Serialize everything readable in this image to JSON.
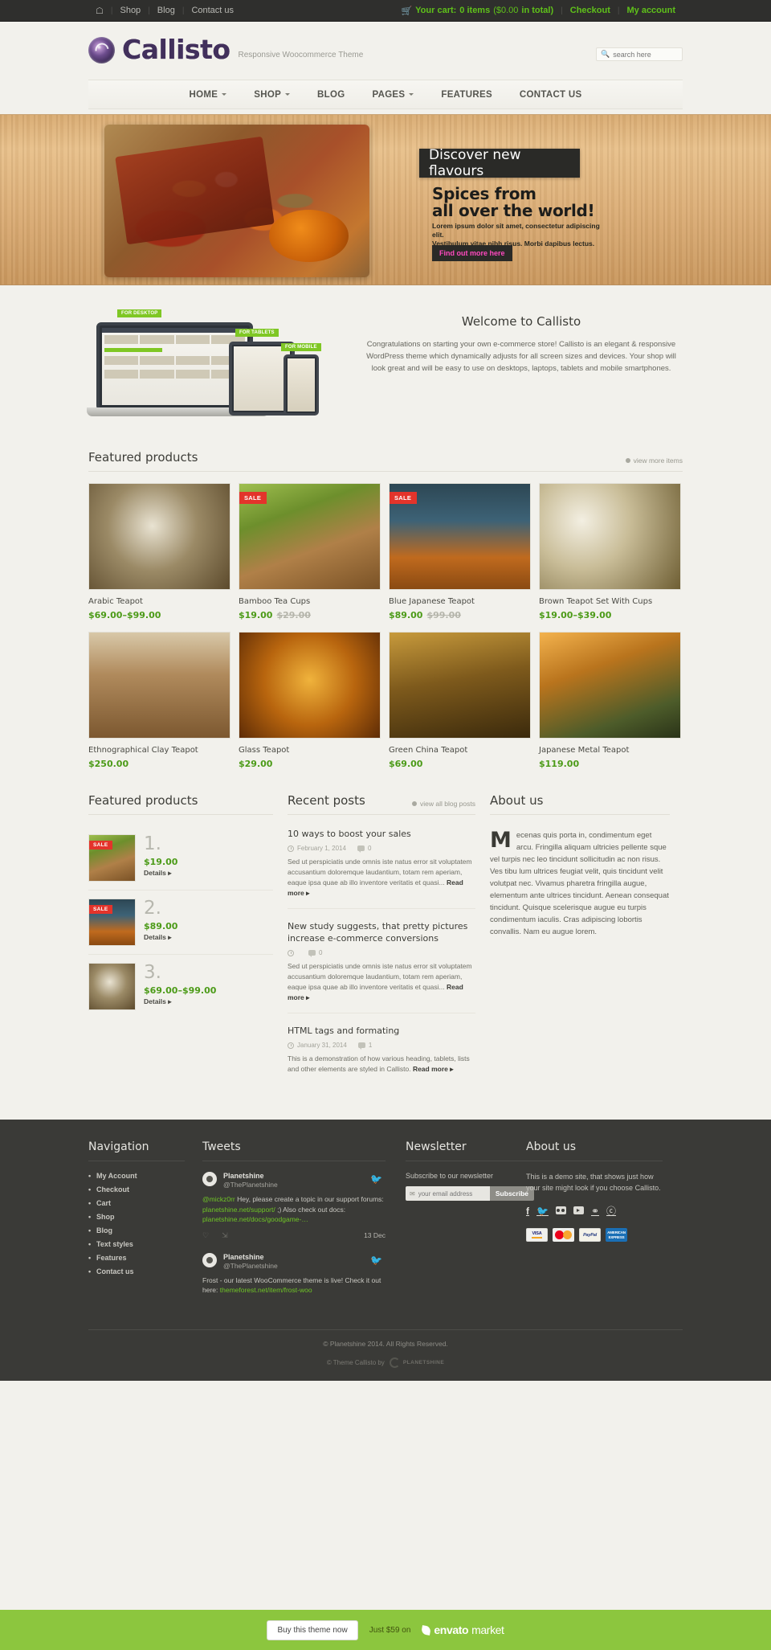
{
  "topbar": {
    "home_icon": "home-icon",
    "links": [
      "Shop",
      "Blog",
      "Contact us"
    ],
    "cart_icon": "cart-icon",
    "cart_label": "Your cart:",
    "cart_items": "0 items",
    "cart_total": "($0.00",
    "cart_total_suffix": "in total)",
    "checkout": "Checkout",
    "account": "My account"
  },
  "header": {
    "logo_text": "Callisto",
    "logo_icon": "spiral-logo-icon",
    "tagline": "Responsive Woocommerce Theme",
    "search_icon": "search-icon",
    "search_placeholder": "search here",
    "search_value": ""
  },
  "nav": {
    "items": [
      {
        "label": "HOME",
        "has_caret": true
      },
      {
        "label": "SHOP",
        "has_caret": true
      },
      {
        "label": "BLOG",
        "has_caret": false
      },
      {
        "label": "PAGES",
        "has_caret": true
      },
      {
        "label": "FEATURES",
        "has_caret": false
      },
      {
        "label": "CONTACT US",
        "has_caret": false
      }
    ]
  },
  "hero": {
    "badge": "Discover new flavours",
    "heading_line1": "Spices from",
    "heading_line2": "all over the world!",
    "paragraph_line1": "Lorem ipsum dolor sit amet, consectetur adipiscing elit.",
    "paragraph_line2": "Vestibulum vitae nibh risus. Morbi dapibus lectus.",
    "button": "Find out more here",
    "button_color": "#ff49c0"
  },
  "welcome": {
    "tags": [
      "FOR DESKTOP",
      "FOR TABLETS",
      "FOR MOBILE"
    ],
    "title": "Welcome to Callisto",
    "text": "Congratulations on starting your own e-commerce store! Callisto is an elegant & responsive WordPress theme which dynamically adjusts for all screen sizes and devices. Your shop will look great and will be easy to use on desktops, laptops, tablets and mobile smartphones."
  },
  "featured_section": {
    "title": "Featured products",
    "link": "view more items"
  },
  "products": [
    {
      "name": "Arabic Teapot",
      "price": "$69.00–$99.00",
      "old_price": "",
      "sale": false,
      "img": "ph1"
    },
    {
      "name": "Bamboo Tea Cups",
      "price": "$19.00",
      "old_price": "$29.00",
      "sale": true,
      "sale_label": "SALE",
      "img": "ph2"
    },
    {
      "name": "Blue Japanese Teapot",
      "price": "$89.00",
      "old_price": "$99.00",
      "sale": true,
      "sale_label": "SALE",
      "img": "ph3"
    },
    {
      "name": "Brown Teapot Set With Cups",
      "price": "$19.00–$39.00",
      "old_price": "",
      "sale": false,
      "img": "ph4"
    },
    {
      "name": "Ethnographical Clay Teapot",
      "price": "$250.00",
      "old_price": "",
      "sale": false,
      "img": "ph5"
    },
    {
      "name": "Glass Teapot",
      "price": "$29.00",
      "old_price": "",
      "sale": false,
      "img": "ph6"
    },
    {
      "name": "Green China Teapot",
      "price": "$69.00",
      "old_price": "",
      "sale": false,
      "img": "ph7"
    },
    {
      "name": "Japanese Metal Teapot",
      "price": "$119.00",
      "old_price": "",
      "sale": false,
      "img": "ph8"
    }
  ],
  "featured_list": {
    "title": "Featured products",
    "items": [
      {
        "num": "1.",
        "price": "$19.00",
        "details": "Details ▸",
        "sale": true,
        "sale_label": "SALE",
        "img": "ph2"
      },
      {
        "num": "2.",
        "price": "$89.00",
        "details": "Details ▸",
        "sale": true,
        "sale_label": "SALE",
        "img": "ph3"
      },
      {
        "num": "3.",
        "price": "$69.00–$99.00",
        "details": "Details ▸",
        "sale": false,
        "img": "ph1"
      }
    ]
  },
  "recent_posts": {
    "title": "Recent posts",
    "link": "view all blog posts",
    "posts": [
      {
        "title": "10 ways to boost your sales",
        "date": "February 1, 2014",
        "comments": "0",
        "excerpt": "Sed ut perspiciatis unde omnis iste natus error sit voluptatem accusantium doloremque laudantium, totam rem aperiam, eaque ipsa quae ab illo inventore veritatis et quasi...",
        "readmore": "Read more ▸"
      },
      {
        "title": "New study suggests, that pretty pictures increase e-commerce conversions",
        "date": "",
        "comments": "0",
        "excerpt": "Sed ut perspiciatis unde omnis iste natus error sit voluptatem accusantium doloremque laudantium, totam rem aperiam, eaque ipsa quae ab illo inventore veritatis et quasi...",
        "readmore": "Read more ▸"
      },
      {
        "title": "HTML tags and formating",
        "date": "January 31, 2014",
        "comments": "1",
        "excerpt": "This is a demonstration of how various heading, tablets, lists and other elements are styled in Callisto.",
        "readmore": "Read more ▸"
      }
    ]
  },
  "about": {
    "title": "About us",
    "dropcap": "M",
    "text": "ecenas quis porta in, condimentum eget arcu. Fringilla aliquam ultricies pellente sque vel turpis nec leo tincidunt sollicitudin ac non risus. Ves tibu lum ultrices feugiat velit, quis tincidunt velit volutpat nec. Vivamus pharetra fringilla augue, elementum ante ultrices tincidunt. Aenean consequat tincidunt. Quisque scelerisque augue eu turpis condimentum iaculis. Cras adipiscing lobortis convallis. Nam eu augue lorem."
  },
  "footer": {
    "navigation": {
      "title": "Navigation",
      "items": [
        "My Account",
        "Checkout",
        "Cart",
        "Shop",
        "Blog",
        "Text styles",
        "Features",
        "Contact us"
      ]
    },
    "tweets": {
      "title": "Tweets",
      "items": [
        {
          "name": "Planetshine",
          "handle": "@ThePlanetshine",
          "mention": "@mickz0rr",
          "text_a": " Hey, please create a topic in our support forums: ",
          "link_a": "planetshine.net/support/",
          "text_b": " ;) Also check out docs: ",
          "link_b": "planetshine.net/docs/goodgame-…",
          "date": "13 Dec",
          "bird_icon": "twitter-bird-icon"
        },
        {
          "name": "Planetshine",
          "handle": "@ThePlanetshine",
          "mention": "",
          "text_a": "Frost - our latest WooCommerce theme is live! Check it out here: ",
          "link_a": "themeforest.net/item/frost-woo",
          "text_b": "",
          "link_b": "",
          "date": "",
          "bird_icon": "twitter-bird-icon"
        }
      ]
    },
    "newsletter": {
      "title": "Newsletter",
      "subtitle": "Subscribe to our newsletter",
      "placeholder": "your email address",
      "value": "",
      "button": "Subscribe",
      "mail_icon": "envelope-icon"
    },
    "about": {
      "title": "About us",
      "text": "This is a demo site, that shows just how your site might look if you choose Callisto.",
      "socials": [
        "facebook-icon",
        "twitter-icon",
        "flickr-icon",
        "youtube-icon",
        "rss-icon",
        "pinterest-icon"
      ],
      "payments": [
        "VISA",
        "MasterCard",
        "PayPal",
        "AMERICAN EXPRESS"
      ]
    },
    "copyright": "© Planetshine 2014. All Rights Reserved.",
    "theme_by": "© Theme Callisto by",
    "theme_author": "PLANETSHINE"
  },
  "envato": {
    "buy_button": "Buy this theme now",
    "price_text": "Just $59 on",
    "market_brand": "envato",
    "market_suffix": "market"
  }
}
